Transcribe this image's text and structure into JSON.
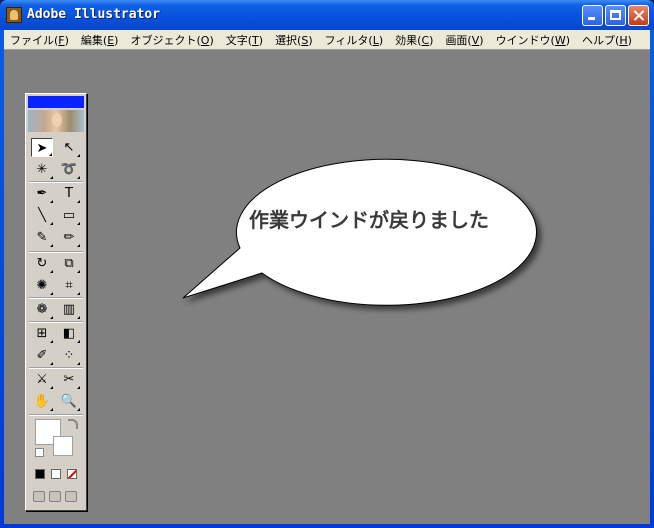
{
  "window": {
    "title": "Adobe Illustrator"
  },
  "menu": [
    {
      "label": "ファイル(",
      "key": "F",
      "tail": ")"
    },
    {
      "label": "編集(",
      "key": "E",
      "tail": ")"
    },
    {
      "label": "オブジェクト(",
      "key": "O",
      "tail": ")"
    },
    {
      "label": "文字(",
      "key": "T",
      "tail": ")"
    },
    {
      "label": "選択(",
      "key": "S",
      "tail": ")"
    },
    {
      "label": "フィルタ(",
      "key": "L",
      "tail": ")"
    },
    {
      "label": "効果(",
      "key": "C",
      "tail": ")"
    },
    {
      "label": "画面(",
      "key": "V",
      "tail": ")"
    },
    {
      "label": "ウインドウ(",
      "key": "W",
      "tail": ")"
    },
    {
      "label": "ヘルプ(",
      "key": "H",
      "tail": ")"
    }
  ],
  "toolbox": {
    "tools": [
      {
        "name": "selection-tool",
        "glyph": "➤"
      },
      {
        "name": "direct-selection-tool",
        "glyph": "↖"
      },
      {
        "name": "magic-wand-tool",
        "glyph": "✳"
      },
      {
        "name": "lasso-tool",
        "glyph": "➰"
      },
      {
        "name": "pen-tool",
        "glyph": "✒"
      },
      {
        "name": "type-tool",
        "glyph": "T"
      },
      {
        "name": "line-tool",
        "glyph": "╲"
      },
      {
        "name": "rectangle-tool",
        "glyph": "▭"
      },
      {
        "name": "paintbrush-tool",
        "glyph": "✎"
      },
      {
        "name": "pencil-tool",
        "glyph": "✏"
      },
      {
        "name": "rotate-tool",
        "glyph": "↻"
      },
      {
        "name": "scale-tool",
        "glyph": "⧉"
      },
      {
        "name": "warp-tool",
        "glyph": "✺"
      },
      {
        "name": "free-transform-tool",
        "glyph": "⌗"
      },
      {
        "name": "symbol-sprayer-tool",
        "glyph": "❁"
      },
      {
        "name": "graph-tool",
        "glyph": "▥"
      },
      {
        "name": "mesh-tool",
        "glyph": "⊞"
      },
      {
        "name": "gradient-tool",
        "glyph": "◧"
      },
      {
        "name": "eyedropper-tool",
        "glyph": "✐"
      },
      {
        "name": "blend-tool",
        "glyph": "⁘"
      },
      {
        "name": "slice-tool",
        "glyph": "⚔"
      },
      {
        "name": "scissors-tool",
        "glyph": "✂"
      },
      {
        "name": "hand-tool",
        "glyph": "✋"
      },
      {
        "name": "zoom-tool",
        "glyph": "🔍"
      }
    ]
  },
  "colors": {
    "fill": "#ffffff",
    "stroke": "#ffffff",
    "black": "#000000",
    "none_slash": "#e00000"
  },
  "callout": {
    "text": "作業ウインドが戻りました"
  }
}
